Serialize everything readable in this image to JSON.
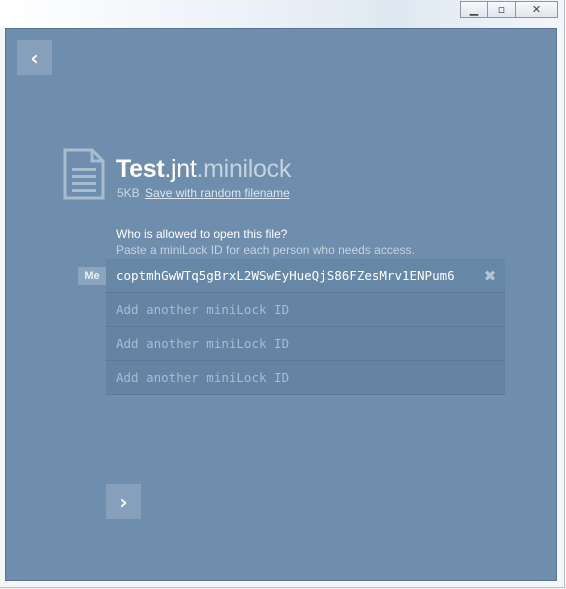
{
  "window": {
    "minimize_glyph": "▁",
    "maximize_glyph": "▫",
    "close_glyph": "✕"
  },
  "nav": {
    "back_glyph": "‹",
    "next_glyph": "›"
  },
  "file": {
    "name_base": "Test",
    "name_mid": ".jnt",
    "name_ext": ".minilock",
    "size": "5KB",
    "save_link": "Save with random filename"
  },
  "recipients": {
    "question": "Who is allowed to open this file?",
    "hint": "Paste a miniLock ID for each person who needs access.",
    "me_label": "Me",
    "ids": [
      {
        "value": "coptmhGwWTq5gBrxL2WSwEyHueQjS86FZesMrv1ENPum6",
        "placeholder": ""
      },
      {
        "value": "",
        "placeholder": "Add another miniLock ID"
      },
      {
        "value": "",
        "placeholder": "Add another miniLock ID"
      },
      {
        "value": "",
        "placeholder": "Add another miniLock ID"
      }
    ],
    "remove_glyph": "✖"
  },
  "colors": {
    "panel_bg": "#6f8dac",
    "button_bg": "#86a0bb",
    "row_bg": "#6583a3"
  }
}
